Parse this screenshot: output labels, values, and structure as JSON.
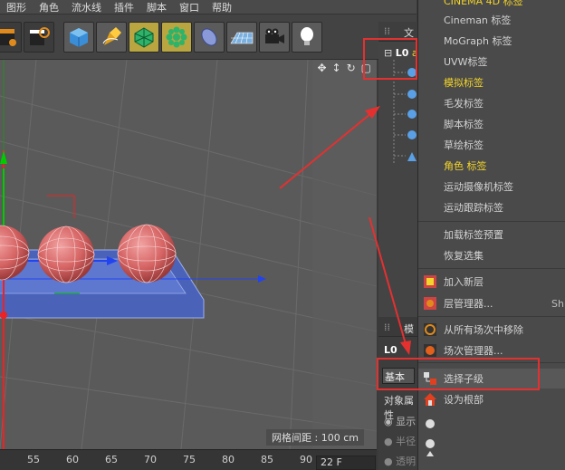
{
  "menubar": {
    "items": [
      "图形",
      "角色",
      "流水线",
      "插件",
      "脚本",
      "窗口",
      "帮助"
    ]
  },
  "toolbar": {
    "buttons": [
      "film-clapper-icon",
      "render-clapper-icon",
      "cube-icon",
      "pen-icon",
      "subdivision-icon",
      "cloner-icon",
      "deformer-icon",
      "floor-icon",
      "camera-icon",
      "light-icon"
    ]
  },
  "viewport": {
    "grid_spacing_label": "网格间距 : 100 cm"
  },
  "timeline": {
    "ruler_ticks": [
      "55",
      "60",
      "65",
      "70",
      "75",
      "80",
      "85",
      "90"
    ],
    "frame_field": "22 F"
  },
  "object_manager": {
    "header_label": "文",
    "root_label": "L0",
    "root_suffix": "a"
  },
  "attribute_manager": {
    "tab_basic": "基本",
    "tab_other": "台",
    "title_label": "对象属性",
    "radio_display": "显示",
    "radio_half": "半径",
    "radio_transparent": "透明",
    "header_icon_label": "L0",
    "header_text": "模"
  },
  "context_menu": {
    "items": [
      {
        "label": "CINEMA 4D 标签",
        "yellow": true
      },
      {
        "label": "Cineman 标签",
        "yellow": false
      },
      {
        "label": "MoGraph 标签",
        "yellow": false
      },
      {
        "label": "UVW标签",
        "yellow": false
      },
      {
        "label": "模拟标签",
        "yellow": true
      },
      {
        "label": "毛发标签",
        "yellow": false
      },
      {
        "label": "脚本标签",
        "yellow": false
      },
      {
        "label": "草绘标签",
        "yellow": false
      },
      {
        "label": "角色 标签",
        "yellow": true
      },
      {
        "label": "运动摄像机标签",
        "yellow": false
      },
      {
        "label": "运动跟踪标签",
        "yellow": false
      },
      {
        "label": "加载标签预置",
        "yellow": false
      },
      {
        "label": "恢复选集",
        "yellow": false
      },
      {
        "label": "加入新层",
        "yellow": false
      },
      {
        "label": "层管理器...",
        "yellow": false
      },
      {
        "label": "从所有场次中移除",
        "yellow": false
      },
      {
        "label": "场次管理器...",
        "yellow": false
      },
      {
        "label": "选择子级",
        "yellow": false
      },
      {
        "label": "设为根部",
        "yellow": false
      }
    ],
    "shortcut_layer": "Sh"
  },
  "colors": {
    "annotation_red": "#e53030",
    "menu_yellow": "#f2d42a",
    "axis_green": "#00cc00",
    "axis_red": "#ee2222",
    "axis_blue": "#2244ee"
  }
}
